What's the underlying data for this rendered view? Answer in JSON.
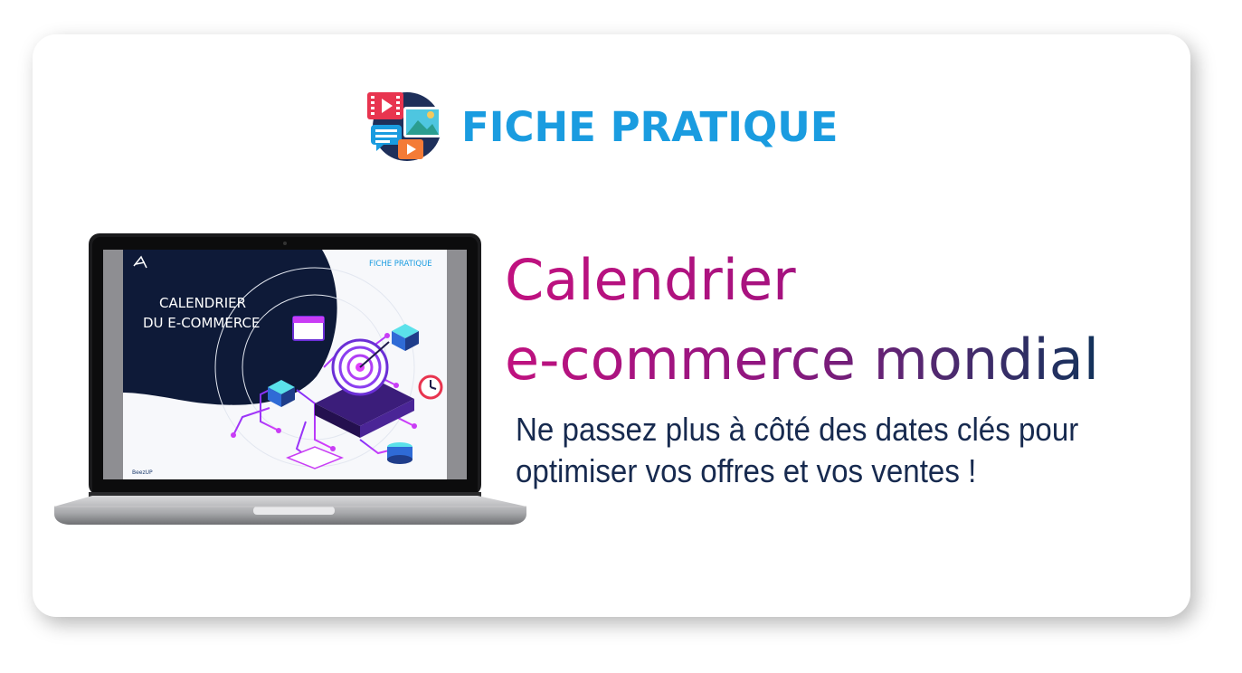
{
  "header": {
    "label": "FICHE PRATIQUE",
    "icon": "media-gallery-icon",
    "accent_color": "#1a9ce0"
  },
  "headline": {
    "line1": "Calendrier",
    "line2": "e-commerce mondial",
    "gradient_start": "#c0117f",
    "gradient_end": "#12325a"
  },
  "subtitle": {
    "line1": "Ne passez plus à côté des dates clés pour",
    "line2": "optimiser vos offres et vos ventes !"
  },
  "laptop_screen": {
    "badge": "FICHE PRATIQUE",
    "title_line1": "CALENDRIER",
    "title_line2": "DU E-COMMERCE",
    "brand": "BeezUP",
    "screen_bg": "#0e1a38"
  }
}
